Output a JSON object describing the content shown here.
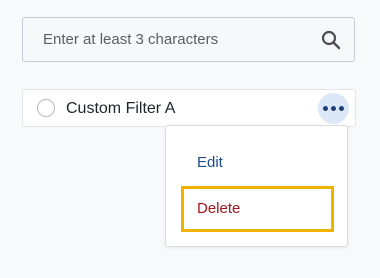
{
  "search": {
    "placeholder": "Enter at least 3 characters",
    "value": "",
    "icon": "search-icon"
  },
  "filters": [
    {
      "label": "Custom Filter A",
      "selected": false,
      "more_icon": "more-horizontal-icon"
    }
  ],
  "menu": {
    "edit_label": "Edit",
    "delete_label": "Delete",
    "highlighted_item": "Delete"
  },
  "colors": {
    "accent_dark_blue": "#1c3f78",
    "edit_text": "#1d4a8a",
    "delete_text": "#a4141b",
    "highlight_border": "#f0b400",
    "more_button_bg": "#dce8f7"
  }
}
